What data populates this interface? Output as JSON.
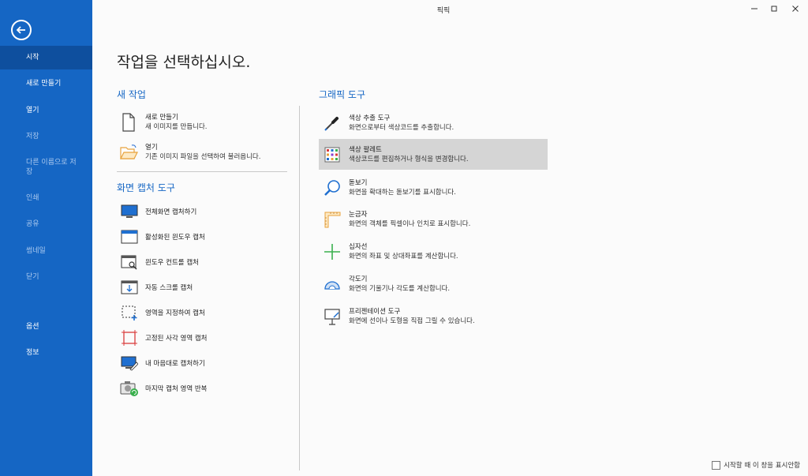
{
  "window": {
    "title": "픽픽"
  },
  "sidebar": {
    "items": [
      {
        "label": "시작"
      },
      {
        "label": "새로 만들기"
      },
      {
        "label": "열기"
      },
      {
        "label": "저장"
      },
      {
        "label": "다른 이름으로 저장"
      },
      {
        "label": "인쇄"
      },
      {
        "label": "공유"
      },
      {
        "label": "썸네일"
      },
      {
        "label": "닫기"
      },
      {
        "label": "옵션"
      },
      {
        "label": "정보"
      }
    ]
  },
  "main": {
    "title": "작업을 선택하십시오.",
    "new_task": {
      "heading": "새 작업",
      "items": [
        {
          "title": "새로 만들기",
          "desc": "새 이미지를 만듭니다."
        },
        {
          "title": "열기",
          "desc": "기존 이미지 파일을 선택하여 불러옵니다."
        }
      ]
    },
    "capture": {
      "heading": "화면 캡처 도구",
      "items": [
        {
          "label": "전체화면 캡처하기"
        },
        {
          "label": "활성화된 윈도우 캡처"
        },
        {
          "label": "윈도우 컨트롤 캡처"
        },
        {
          "label": "자동 스크롤 캡처"
        },
        {
          "label": "영역을 지정하여 캡처"
        },
        {
          "label": "고정된 사각 영역 캡처"
        },
        {
          "label": "내 마음대로 캡처하기"
        },
        {
          "label": "마지막 캡처 영역 반복"
        }
      ]
    },
    "graphic": {
      "heading": "그래픽 도구",
      "items": [
        {
          "title": "색상 추출 도구",
          "desc": "화면으로부터 색상코드를 추출합니다."
        },
        {
          "title": "색상 팔레트",
          "desc": "색상코드를 편집하거나 형식을 변경합니다."
        },
        {
          "title": "돋보기",
          "desc": "화면을 확대하는 돋보기를 표시합니다."
        },
        {
          "title": "눈금자",
          "desc": "화면의 객체를 픽셀이나 인치로 표시합니다."
        },
        {
          "title": "십자선",
          "desc": "화면의 좌표 및 상대좌표를 계산합니다."
        },
        {
          "title": "각도기",
          "desc": "화면의 기울기나 각도를 계산합니다."
        },
        {
          "title": "프리젠테이션 도구",
          "desc": "화면에 선이나 도형을 직접 그릴 수 있습니다."
        }
      ]
    },
    "startup_checkbox": {
      "label": "시작할 때 이 창을 표시안함"
    }
  },
  "colors": {
    "sidebar": "#1566c4",
    "sidebar_active": "#0e4f9e",
    "accent": "#1566c4",
    "selected_row": "#d5d5d5"
  }
}
